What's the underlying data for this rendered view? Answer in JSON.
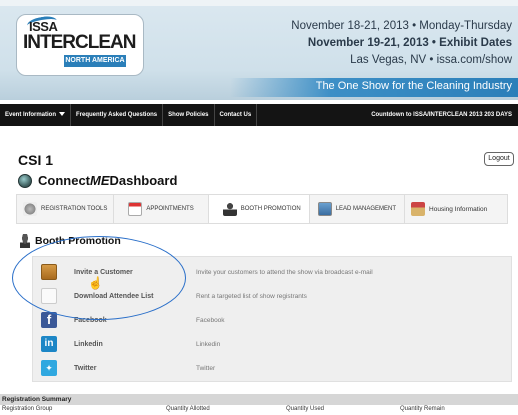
{
  "banner": {
    "logo": {
      "top": "ISSA",
      "main": "INTERCLEAN",
      "region": "NORTH AMERICA"
    },
    "line1": "November 18-21, 2013 • Monday-Thursday",
    "line2": "November 19-21, 2013 • Exhibit Dates",
    "line3": "Las Vegas, NV • issa.com/show",
    "tagline": "The One Show for the Cleaning Industry"
  },
  "navbar": {
    "items": [
      "Event Information",
      "Frequently Asked Questions",
      "Show Policies",
      "Contact Us"
    ],
    "countdown": "Countdown to ISSA/INTERCLEAN 2013  203 DAYS"
  },
  "header": {
    "company": "CSI 1",
    "logout": "Logout",
    "dashboard_prefix": "Connect",
    "dashboard_emph": "ME",
    "dashboard_suffix": " Dashboard"
  },
  "tabs": [
    {
      "label": "REGISTRATION TOOLS",
      "icon": "gear-icon",
      "active": false
    },
    {
      "label": "APPOINTMENTS",
      "icon": "calendar-icon",
      "active": false
    },
    {
      "label": "BOOTH PROMOTION",
      "icon": "person-icon",
      "active": true
    },
    {
      "label": "LEAD MANAGEMENT",
      "icon": "lead-icon",
      "active": false
    },
    {
      "label": "Housing Information",
      "icon": "house-icon",
      "active": false
    }
  ],
  "section": {
    "title": "Booth Promotion",
    "rows": [
      {
        "label": "Invite a Customer",
        "desc": "Invite your customers to attend the show via broadcast e-mail",
        "icon": "invite-icon"
      },
      {
        "label": "Download Attendee List",
        "desc": "Rent a targeted list of show registrants",
        "icon": "download-icon"
      },
      {
        "label": "Facebook",
        "desc": "Facebook",
        "icon": "facebook-icon"
      },
      {
        "label": "Linkedin",
        "desc": "Linkedin",
        "icon": "linkedin-icon"
      },
      {
        "label": "Twitter",
        "desc": "Twitter",
        "icon": "twitter-icon"
      }
    ]
  },
  "registration_summary": {
    "title": "Registration Summary",
    "columns": [
      "Registration Group",
      "Quantity Allotted",
      "Quantity Used",
      "Quantity Remain"
    ]
  }
}
